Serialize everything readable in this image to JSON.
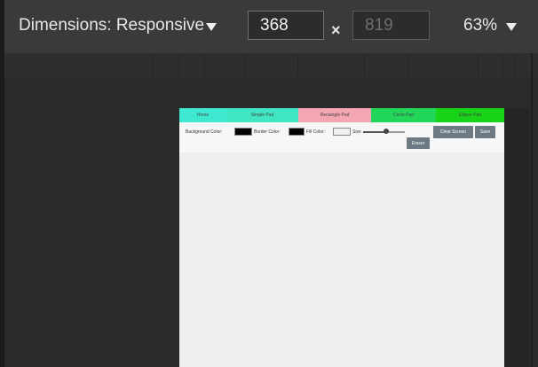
{
  "toolbar": {
    "dimensions_label": "Dimensions: Responsive",
    "width_value": "368",
    "times_symbol": "×",
    "height_placeholder": "819",
    "zoom_label": "63%"
  },
  "icons": {
    "dimensions_dropdown": "chevron-down-icon",
    "zoom_dropdown": "chevron-down-icon"
  },
  "app": {
    "nav_tabs": [
      {
        "label": "Home",
        "color": "#3fe8d0"
      },
      {
        "label": "Simple Pad",
        "color": "#40e6c3"
      },
      {
        "label": "Rectangle Pad",
        "color": "#f4a6b3"
      },
      {
        "label": "Circle Pad",
        "color": "#22d65a"
      },
      {
        "label": "Ellipse Pad",
        "color": "#18d418"
      }
    ],
    "controls": {
      "background_color_label": "Background Color:",
      "background_color": "#000000",
      "border_color_label": "Border Color:",
      "border_color": "#000000",
      "fill_color_label": "Fill Color:",
      "fill_color": "#f0f0f0",
      "size_label": "Size",
      "size_fraction": 0.55,
      "clear_label": "Clear Screen",
      "save_label": "Save",
      "eraser_label": "Eraser"
    }
  },
  "colors": {
    "toolbar_bg": "#3a3a3a",
    "background": "#2b2b2b",
    "button": "#6d7a83"
  }
}
